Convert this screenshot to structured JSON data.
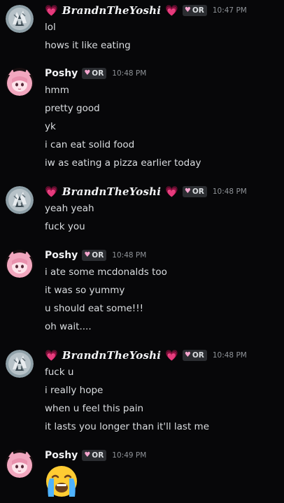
{
  "groups": [
    {
      "author": "BrandnTheYoshi",
      "fancy": true,
      "heart": "💗",
      "tag": "OR",
      "time": "10:47 PM",
      "lines": [
        "lol",
        "hows it like eating"
      ]
    },
    {
      "author": "Poshy",
      "fancy": false,
      "tag": "OR",
      "time": "10:48 PM",
      "lines": [
        "hmm",
        "pretty good",
        "yk",
        "i can eat solid food",
        "iw as eating a pizza earlier today"
      ]
    },
    {
      "author": "BrandnTheYoshi",
      "fancy": true,
      "heart": "💗",
      "tag": "OR",
      "time": "10:48 PM",
      "lines": [
        "yeah yeah",
        "fuck you"
      ]
    },
    {
      "author": "Poshy",
      "fancy": false,
      "tag": "OR",
      "time": "10:48 PM",
      "lines": [
        "i ate some mcdonalds too",
        "it was so yummy",
        "u should eat some!!!",
        "oh wait...."
      ]
    },
    {
      "author": "BrandnTheYoshi",
      "fancy": true,
      "heart": "💗",
      "tag": "OR",
      "time": "10:48 PM",
      "lines": [
        "fuck u",
        "i really hope",
        "when u feel this pain",
        "it lasts you longer than it'll last me"
      ]
    },
    {
      "author": "Poshy",
      "fancy": false,
      "tag": "OR",
      "time": "10:49 PM",
      "lines": [],
      "emoji": "loudly-crying-face"
    }
  ],
  "colors": {
    "background": "#070709",
    "text": "#dbdee1",
    "username": "#f2f3f5",
    "timestamp": "#8e9297",
    "tag_bg": "#2b2d31",
    "heart": "#ff4fa0",
    "poshy_avatar_hair": "#f2a7bf",
    "yoshi_avatar_bg": "#8fa0a8"
  },
  "icons": {
    "heart": "growing-heart-icon",
    "tag": "heart-tag-icon",
    "emoji": "loudly-crying-face-icon"
  }
}
